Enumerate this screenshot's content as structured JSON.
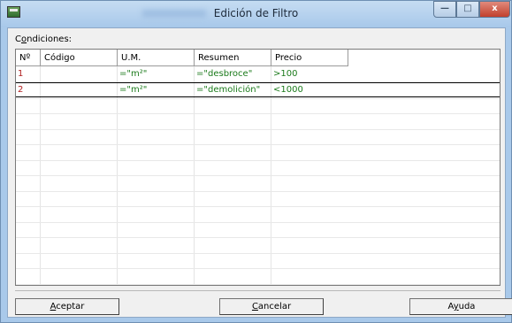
{
  "window": {
    "title": "Edición de Filtro",
    "min_glyph": "—",
    "max_glyph": "□",
    "close_glyph": "x"
  },
  "conditions": {
    "label_first": "C",
    "label_ul": "o",
    "label_rest": "ndiciones:"
  },
  "table": {
    "columns": [
      "Nº",
      "Código",
      "U.M.",
      "Resumen",
      "Precio"
    ],
    "rows": [
      {
        "n": "1",
        "codigo": "",
        "um": "=\"m²\"",
        "resumen": "=\"desbroce\"",
        "precio": ">100"
      },
      {
        "n": "2",
        "codigo": "",
        "um": "=\"m²\"",
        "resumen": " =\"demolición\"",
        "precio": "<1000"
      }
    ]
  },
  "buttons": {
    "accept": {
      "ul": "A",
      "rest": "ceptar"
    },
    "cancel": {
      "ul": "C",
      "rest": "ancelar"
    },
    "help": {
      "pre": "A",
      "ul": "y",
      "rest": "uda"
    }
  },
  "colors": {
    "row_number": "#b02020",
    "condition_value": "#1a7a1a",
    "title_bar": "#a9c9ea",
    "close_button": "#c1402d"
  }
}
